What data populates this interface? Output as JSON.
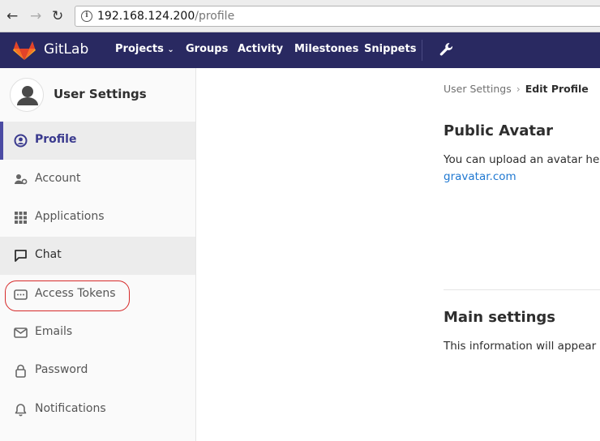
{
  "browser": {
    "url_host": "192.168.124.200",
    "url_path": "/profile"
  },
  "header": {
    "brand": "GitLab",
    "nav": [
      "Projects",
      "Groups",
      "Activity",
      "Milestones",
      "Snippets"
    ]
  },
  "sidebar": {
    "title": "User Settings",
    "items": [
      {
        "label": "Profile",
        "icon": "user-circle-icon"
      },
      {
        "label": "Account",
        "icon": "user-gear-icon"
      },
      {
        "label": "Applications",
        "icon": "grid-icon"
      },
      {
        "label": "Chat",
        "icon": "chat-icon"
      },
      {
        "label": "Access Tokens",
        "icon": "token-icon"
      },
      {
        "label": "Emails",
        "icon": "envelope-icon"
      },
      {
        "label": "Password",
        "icon": "lock-icon"
      },
      {
        "label": "Notifications",
        "icon": "bell-icon"
      }
    ]
  },
  "main": {
    "breadcrumb_parent": "User Settings",
    "breadcrumb_current": "Edit Profile",
    "avatar_title": "Public Avatar",
    "avatar_text": "You can upload an avatar here or change it at",
    "avatar_link": "gravatar.com",
    "main_title": "Main settings",
    "main_text": "This information will appear on your profile."
  },
  "colors": {
    "header_bg": "#292961",
    "active_accent": "#4b4ba3",
    "link": "#1f78d1",
    "annotation": "#d62a2a"
  }
}
